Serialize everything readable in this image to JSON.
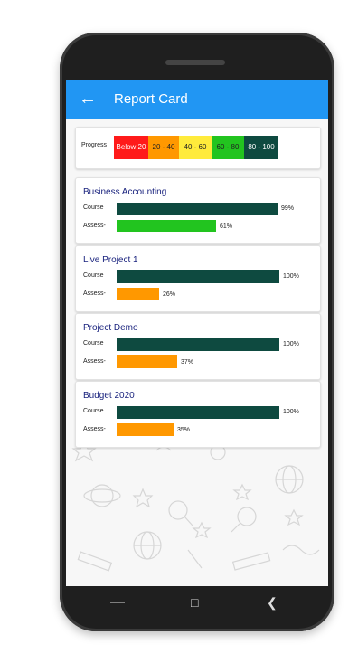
{
  "appbar": {
    "title": "Report Card",
    "back_icon": "arrow-left-icon",
    "color": "#2196f3"
  },
  "legend": {
    "label": "Progress",
    "ranges": [
      {
        "label": "Below 20",
        "color": "#ff1a1a",
        "text_color": "#ffffff"
      },
      {
        "label": "20 - 40",
        "color": "#ff9800",
        "text_color": "#222222"
      },
      {
        "label": "40 - 60",
        "color": "#ffeb3b",
        "text_color": "#222222"
      },
      {
        "label": "60 - 80",
        "color": "#22c41f",
        "text_color": "#222222"
      },
      {
        "label": "80 - 100",
        "color": "#0e4a40",
        "text_color": "#ffffff"
      }
    ]
  },
  "courses": [
    {
      "name": "Business Accounting",
      "course_label": "Course",
      "course_pct": "99%",
      "course_value": 99,
      "course_color": "#0e4a40",
      "assess_label": "Assess-",
      "assess_pct": "61%",
      "assess_value": 61,
      "assess_color": "#22c41f"
    },
    {
      "name": "Live Project 1",
      "course_label": "Course",
      "course_pct": "100%",
      "course_value": 100,
      "course_color": "#0e4a40",
      "assess_label": "Assess-",
      "assess_pct": "26%",
      "assess_value": 26,
      "assess_color": "#ff9800"
    },
    {
      "name": "Project Demo",
      "course_label": "Course",
      "course_pct": "100%",
      "course_value": 100,
      "course_color": "#0e4a40",
      "assess_label": "Assess-",
      "assess_pct": "37%",
      "assess_value": 37,
      "assess_color": "#ff9800"
    },
    {
      "name": "Budget 2020",
      "course_label": "Course",
      "course_pct": "100%",
      "course_value": 100,
      "course_color": "#0e4a40",
      "assess_label": "Assess-",
      "assess_pct": "35%",
      "assess_value": 35,
      "assess_color": "#ff9800"
    }
  ],
  "navbar": {
    "recents_icon": "recents-square-icon",
    "home_icon": "home-icon",
    "back_icon": "back-triangle-icon"
  }
}
